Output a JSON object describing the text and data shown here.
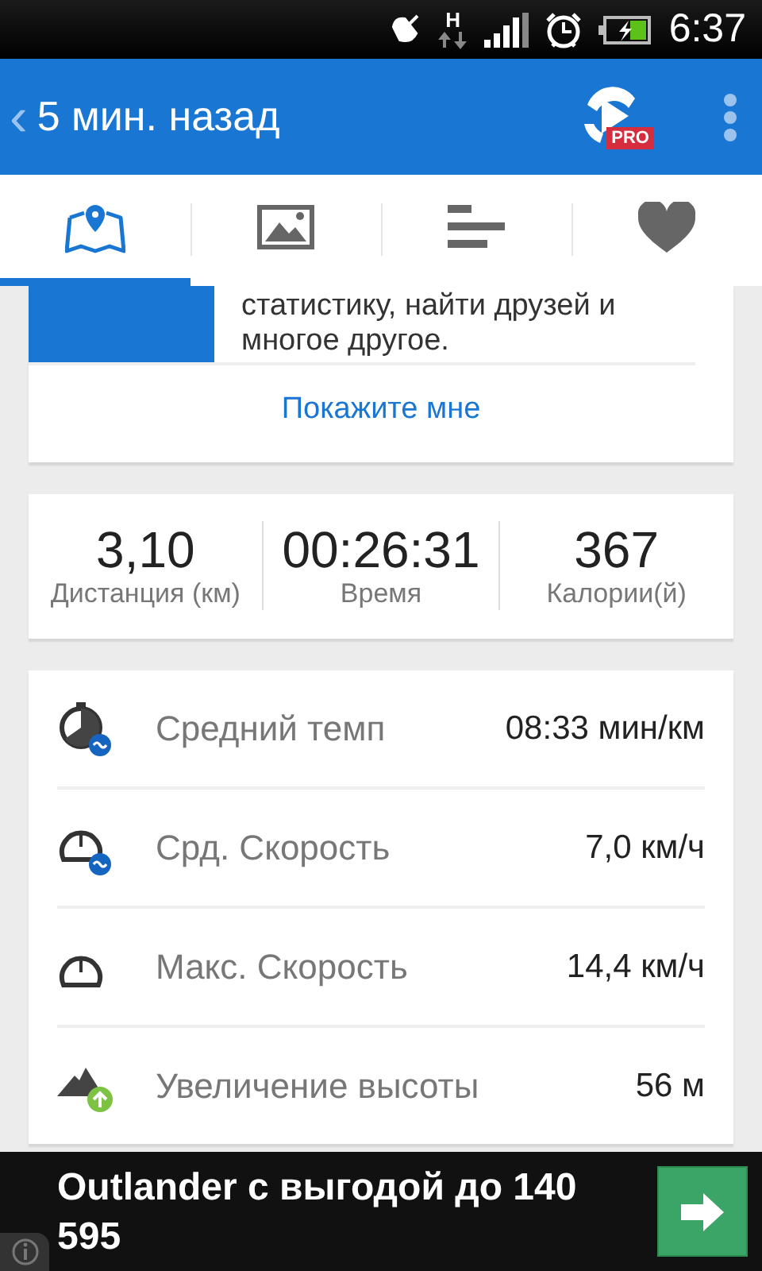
{
  "status_bar": {
    "network": "H",
    "time": "6:37"
  },
  "toolbar": {
    "back": "‹",
    "title": "5 мин. назад",
    "badge": "PRO"
  },
  "tabs": [
    {
      "kind": "map",
      "selected": true
    },
    {
      "kind": "photo",
      "selected": false
    },
    {
      "kind": "stats",
      "selected": false
    },
    {
      "kind": "heart",
      "selected": false
    }
  ],
  "promo": {
    "text": "статистику, найти друзей и многое другое.",
    "link": "Покажите мне"
  },
  "summary": [
    {
      "value": "3,10",
      "label": "Дистанция (км)"
    },
    {
      "value": "00:26:31",
      "label": "Время"
    },
    {
      "value": "367",
      "label": "Калории(й)"
    }
  ],
  "stats": [
    {
      "kind": "pace",
      "label": "Средний темп",
      "value": "08:33 мин/км"
    },
    {
      "kind": "avg-speed",
      "label": "Срд. Скорость",
      "value": "7,0 км/ч"
    },
    {
      "kind": "max-speed",
      "label": "Макс. Скорость",
      "value": "14,4 км/ч"
    },
    {
      "kind": "elevation",
      "label": "Увеличение высоты",
      "value": "56 м"
    }
  ],
  "ad": {
    "text": "Outlander с выгодой до 140 595"
  }
}
